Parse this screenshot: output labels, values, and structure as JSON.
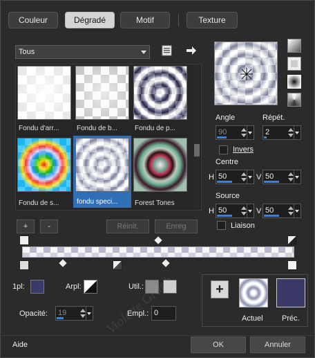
{
  "tabs": [
    "Couleur",
    "Dégradé",
    "Motif",
    "Texture"
  ],
  "active_tab": "Dégradé",
  "filter": {
    "value": "Tous"
  },
  "gradients": [
    {
      "label": "Fondu d'arr..."
    },
    {
      "label": "Fondu de b..."
    },
    {
      "label": "Fondu de p..."
    },
    {
      "label": "Fondu de s..."
    },
    {
      "label": "fondu speci..."
    },
    {
      "label": "Forest Tones"
    }
  ],
  "selected_gradient": "fondu speci...",
  "list_buttons": {
    "add": "+",
    "remove": "-",
    "reset": "Réinit.",
    "save": "Enreg"
  },
  "angle": {
    "label": "Angle",
    "value": "90"
  },
  "repeat": {
    "label": "Répét.",
    "value": "2"
  },
  "invert": {
    "label": "Invers"
  },
  "centre": {
    "label": "Centre",
    "h_label": "H",
    "h": "50",
    "v_label": "V",
    "v": "50"
  },
  "source": {
    "label": "Source",
    "h_label": "H",
    "h": "50",
    "v_label": "V",
    "v": "50"
  },
  "link": {
    "label": "Liaison"
  },
  "bottom": {
    "pl_label": "1pl:",
    "arpl_label": "Arpl:",
    "util_label": "Util.:",
    "opacity_label": "Opacité:",
    "opacity_value": "19",
    "empl_label": "Empl.:",
    "empl_value": "0"
  },
  "preview": {
    "current": "Actuel",
    "previous": "Préc."
  },
  "footer": {
    "help": "Aide",
    "ok": "OK",
    "cancel": "Annuler"
  },
  "watermark": "Violette Graph",
  "colors": {
    "selection": "#2f6fb8",
    "swatch_prev": "#3b3a66",
    "swatch_1pl": "#3a3a6a"
  }
}
